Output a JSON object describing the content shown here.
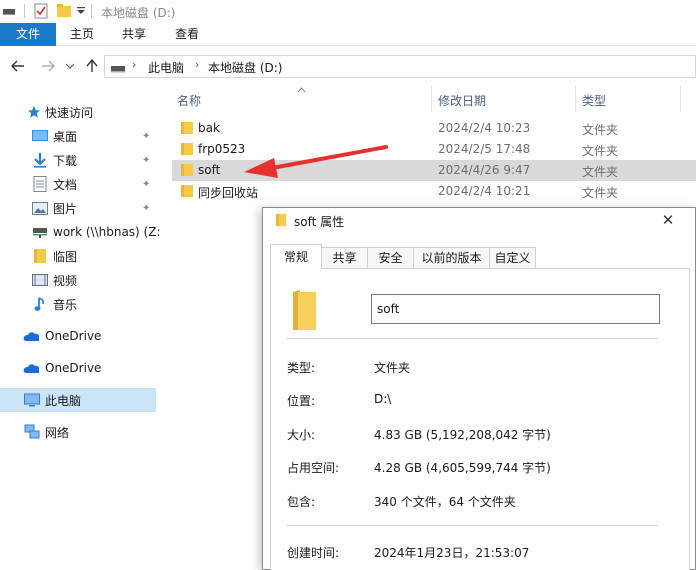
{
  "window": {
    "title": "本地磁盘 (D:)"
  },
  "ribbon": {
    "tabs": [
      "文件",
      "主页",
      "共享",
      "查看"
    ]
  },
  "address": {
    "crumbs": [
      "此电脑",
      "本地磁盘 (D:)"
    ]
  },
  "sidebar": {
    "items": [
      {
        "label": "快速访问",
        "icon": "star-icon"
      },
      {
        "label": "桌面",
        "icon": "desktop-icon",
        "pinned": true
      },
      {
        "label": "下载",
        "icon": "download-icon",
        "pinned": true
      },
      {
        "label": "文档",
        "icon": "document-icon",
        "pinned": true
      },
      {
        "label": "图片",
        "icon": "picture-icon",
        "pinned": true
      },
      {
        "label": "work (\\\\hbnas) (Z:",
        "icon": "network-drive-icon"
      },
      {
        "label": "临图",
        "icon": "folder-icon"
      },
      {
        "label": "视频",
        "icon": "video-icon"
      },
      {
        "label": "音乐",
        "icon": "music-icon"
      },
      {
        "label": "OneDrive",
        "icon": "cloud-icon"
      },
      {
        "label": "OneDrive",
        "icon": "cloud-icon"
      },
      {
        "label": "此电脑",
        "icon": "computer-icon",
        "selected": true
      },
      {
        "label": "网络",
        "icon": "network-icon"
      }
    ]
  },
  "filelist": {
    "columns": [
      "名称",
      "修改日期",
      "类型"
    ],
    "rows": [
      {
        "name": "bak",
        "date": "2024/2/4 10:23",
        "type": "文件夹"
      },
      {
        "name": "frp0523",
        "date": "2024/2/5 17:48",
        "type": "文件夹"
      },
      {
        "name": "soft",
        "date": "2024/4/26 9:47",
        "type": "文件夹",
        "selected": true
      },
      {
        "name": "同步回收站",
        "date": "2024/2/4 10:21",
        "type": "文件夹"
      }
    ]
  },
  "dialog": {
    "title": "soft 属性",
    "close": "✕",
    "tabs": [
      "常规",
      "共享",
      "安全",
      "以前的版本",
      "自定义"
    ],
    "name_value": "soft",
    "props": [
      {
        "label": "类型:",
        "value": "文件夹"
      },
      {
        "label": "位置:",
        "value": "D:\\"
      },
      {
        "label": "大小:",
        "value": "4.83 GB (5,192,208,042 字节)"
      },
      {
        "label": "占用空间:",
        "value": "4.28 GB (4,605,599,744 字节)"
      },
      {
        "label": "包含:",
        "value": "340 个文件，64 个文件夹"
      },
      {
        "label": "创建时间:",
        "value": "2024年1月23日，21:53:07"
      }
    ]
  },
  "colors": {
    "accent": "#1979ca",
    "selection": "#cce4f7",
    "row_selected": "#d9d9d9",
    "arrow": "#e8302e",
    "folder": "#f5c94a"
  }
}
